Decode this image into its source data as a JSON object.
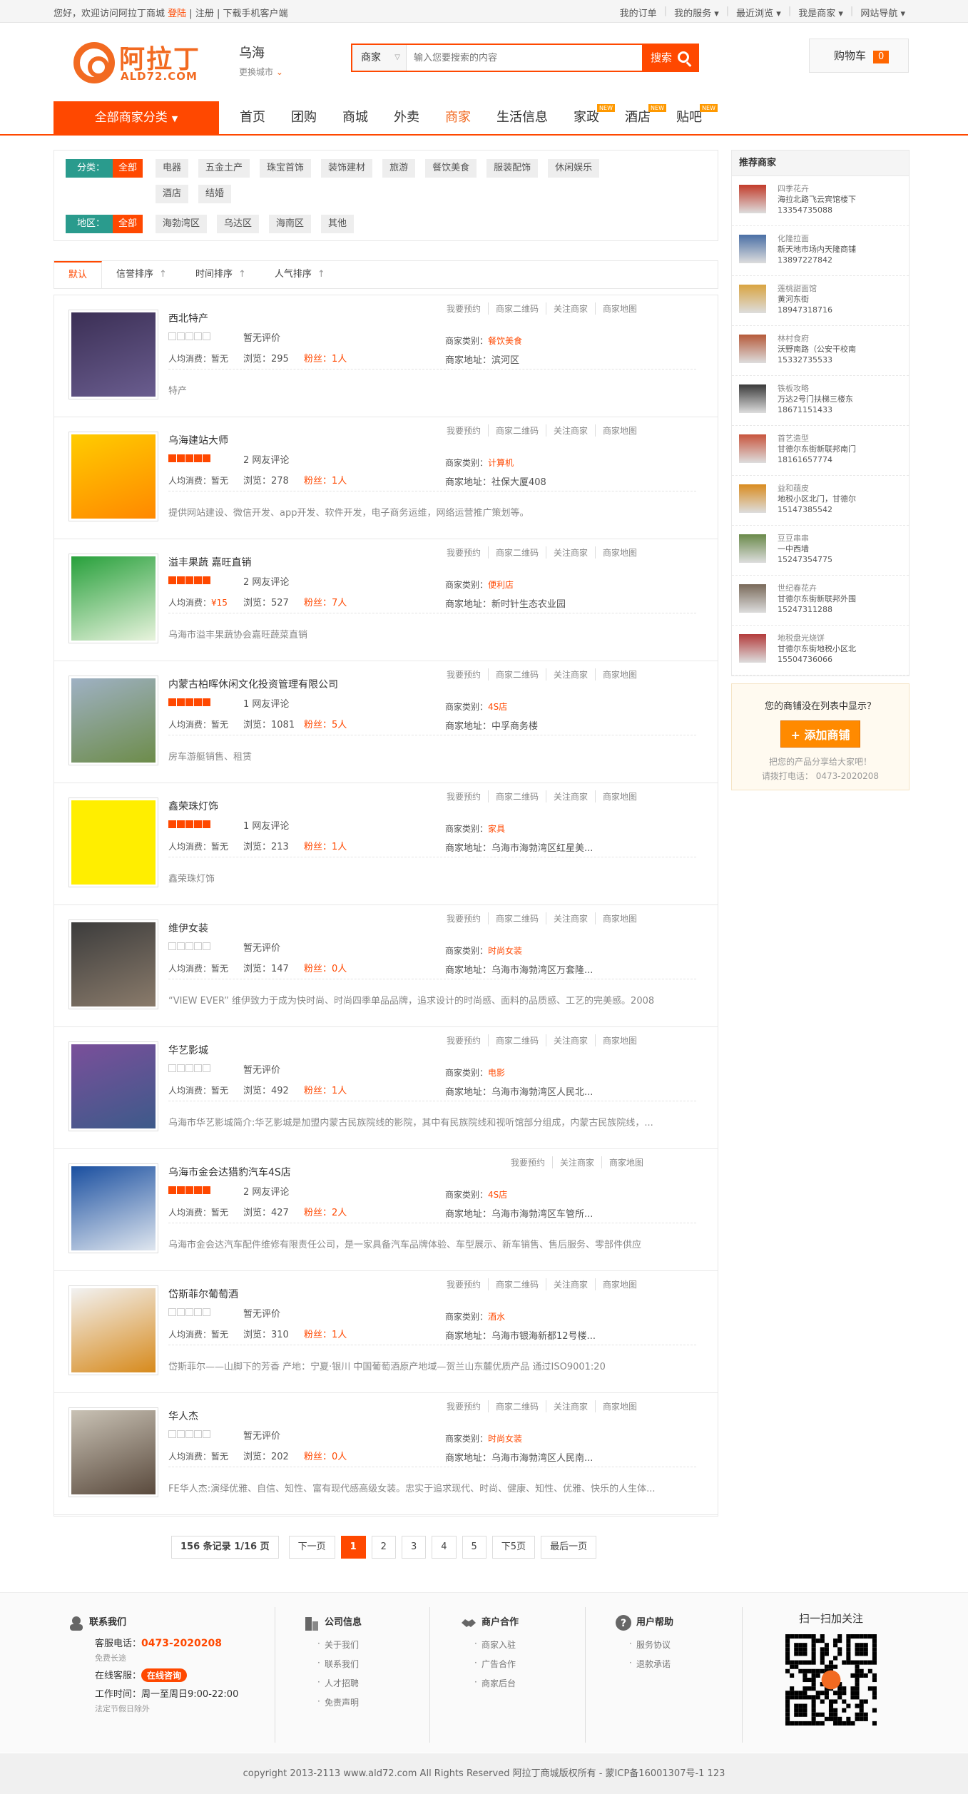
{
  "topbar": {
    "welcome": "您好，欢迎访问阿拉丁商城",
    "login": "登陆",
    "register": "注册",
    "app": "下载手机客户端",
    "links": [
      "我的订单",
      "我的服务",
      "最近浏览",
      "我是商家",
      "网站导航"
    ]
  },
  "logo": {
    "cn": "阿拉丁",
    "en": "ALD72.COM"
  },
  "city": {
    "name": "乌海",
    "change": "更换城市"
  },
  "search": {
    "type": "商家",
    "placeholder": "输入您要搜索的内容",
    "button": "搜索"
  },
  "cart": {
    "label": "购物车",
    "count": "0"
  },
  "nav": {
    "all": "全部商家分类",
    "items": [
      {
        "label": "首页"
      },
      {
        "label": "团购"
      },
      {
        "label": "商城"
      },
      {
        "label": "外卖"
      },
      {
        "label": "商家"
      },
      {
        "label": "生活信息"
      },
      {
        "label": "家政",
        "badge": "NEW"
      },
      {
        "label": "酒店",
        "badge": "NEW"
      },
      {
        "label": "贴吧",
        "badge": "NEW"
      }
    ]
  },
  "filter": {
    "cat_label": "分类：",
    "all": "全部",
    "cats": [
      "电器",
      "五金土产",
      "珠宝首饰",
      "装饰建材",
      "旅游",
      "餐饮美食",
      "服装配饰",
      "休闲娱乐",
      "酒店",
      "结婚"
    ],
    "area_label": "地区：",
    "areas": [
      "海勃湾区",
      "乌达区",
      "海南区",
      "其他"
    ]
  },
  "sort": [
    "默认",
    "信誉排序",
    "时间排序",
    "人气排序"
  ],
  "labels": {
    "avg": "人均消费：",
    "cat": "商家类别：",
    "addr": "商家地址："
  },
  "ops": [
    "我要预约",
    "商家二维码",
    "关注商家",
    "商家地图"
  ],
  "merchants": [
    {
      "name": "西北特产",
      "rating": "暂无评价",
      "avg": "暂无",
      "views": "浏览：295",
      "fans": "粉丝：1人",
      "cat": "餐饮美食",
      "addr": "滨河区",
      "desc": "特产"
    },
    {
      "name": "乌海建站大师",
      "rating": "2 网友评论",
      "avg": "暂无",
      "views": "浏览：278",
      "fans": "粉丝：1人",
      "cat": "计算机",
      "addr": "社保大厦408",
      "desc": "提供网站建设、微信开发、app开发、软件开发，电子商务运维，网络运营推广策划等。"
    },
    {
      "name": "溢丰果蔬 嘉旺直销",
      "rating": "2 网友评论",
      "avg": "¥15",
      "views": "浏览：527",
      "fans": "粉丝：7人",
      "cat": "便利店",
      "addr": "新时针生态农业园",
      "desc": "乌海市溢丰果蔬协会嘉旺蔬菜直销"
    },
    {
      "name": "内蒙古柏晖休闲文化投资管理有限公司",
      "rating": "1 网友评论",
      "avg": "暂无",
      "views": "浏览：1081",
      "fans": "粉丝：5人",
      "cat": "4S店",
      "addr": "中孚商务楼",
      "desc": "房车游艇销售、租赁"
    },
    {
      "name": "鑫荣珠灯饰",
      "rating": "1 网友评论",
      "avg": "暂无",
      "views": "浏览：213",
      "fans": "粉丝：1人",
      "cat": "家具",
      "addr": "乌海市海勃湾区红星美...",
      "desc": "鑫荣珠灯饰"
    },
    {
      "name": "维伊女装",
      "rating": "暂无评价",
      "avg": "暂无",
      "views": "浏览：147",
      "fans": "粉丝：0人",
      "cat": "时尚女装",
      "addr": "乌海市海勃湾区万套隆...",
      "desc": "“VIEW EVER” 维伊致力于成为快时尚、时尚四季单品品牌，追求设计的时尚感、面料的品质感、工艺的完美感。2008"
    },
    {
      "name": "华艺影城",
      "rating": "暂无评价",
      "avg": "暂无",
      "views": "浏览：492",
      "fans": "粉丝：1人",
      "cat": "电影",
      "addr": "乌海市海勃湾区人民北...",
      "desc": "乌海市华艺影城简介:华艺影城是加盟内蒙古民族院线的影院，其中有民族院线和视听馆部分组成，内蒙古民族院线，..."
    },
    {
      "name": "乌海市金会达猎豹汽车4S店",
      "rating": "2 网友评论",
      "avg": "暂无",
      "views": "浏览：427",
      "fans": "粉丝：2人",
      "cat": "4S店",
      "addr": "乌海市海勃湾区车管所...",
      "desc": "乌海市金会达汽车配件维修有限责任公司，是一家具备汽车品牌体验、车型展示、新车销售、售后服务、零部件供应"
    },
    {
      "name": "岱斯菲尔葡萄酒",
      "rating": "暂无评价",
      "avg": "暂无",
      "views": "浏览：310",
      "fans": "粉丝：1人",
      "cat": "酒水",
      "addr": "乌海市银海新都12号楼...",
      "desc": "岱斯菲尔——山脚下的芳香 产地：宁夏·银川 中国葡萄酒原产地域—贺兰山东麓优质产品 通过ISO9001:20"
    },
    {
      "name": "华人杰",
      "rating": "暂无评价",
      "avg": "暂无",
      "views": "浏览：202",
      "fans": "粉丝：0人",
      "cat": "时尚女装",
      "addr": "乌海市海勃湾区人民南...",
      "desc": "FE华人杰:演绎优雅、自信、知性、富有现代感高级女装。忠实于追求现代、时尚、健康、知性、优雅、快乐的人生体..."
    }
  ],
  "pager": {
    "records": "156 条记录 1/16 页",
    "prev": "下一页",
    "pages": [
      "1",
      "2",
      "3",
      "4",
      "5"
    ],
    "next5": "下5页",
    "last": "最后一页"
  },
  "side": {
    "title": "推荐商家",
    "shops": [
      {
        "name": "四季花卉",
        "addr": "海拉北路飞云宾馆楼下",
        "tel": "13354735088"
      },
      {
        "name": "化隆拉面",
        "addr": "新天地市场内天隆商铺",
        "tel": "13897227842"
      },
      {
        "name": "莲桃甜面馆",
        "addr": "黄河东街",
        "tel": "18947318716"
      },
      {
        "name": "林村食府",
        "addr": "沃野南路（公安干校南",
        "tel": "15332735533"
      },
      {
        "name": "铁板攻略",
        "addr": "万达2号门扶梯三楼东",
        "tel": "18671151433"
      },
      {
        "name": "首艺造型",
        "addr": "甘德尔东街新联邦南门",
        "tel": "18161657774"
      },
      {
        "name": "益和蕴皮",
        "addr": "地税小区北门，甘德尔",
        "tel": "15147385542"
      },
      {
        "name": "豆豆串串",
        "addr": "一中西墙",
        "tel": "15247354775"
      },
      {
        "name": "世纪春花卉",
        "addr": "甘德尔东街新联邦外围",
        "tel": "15247311288"
      },
      {
        "name": "地税盘光烧饼",
        "addr": "甘德尔东街地税小区北",
        "tel": "15504736066"
      }
    ],
    "add_q": "您的商铺没在列表中显示？",
    "add_btn": "+ 添加商铺",
    "add_s1": "把您的产品分享给大家吧！",
    "add_s2": "请拨打电话： 0473-2020208"
  },
  "footer": {
    "contact": {
      "title": "联系我们",
      "tel_label": "客服电话：",
      "tel": "0473-2020208",
      "free": "免费长途",
      "online_label": "在线客服：",
      "online": "在线咨询",
      "hours": "工作时间：周一至周日9:00-22:00",
      "holiday": "法定节假日除外"
    },
    "company": {
      "title": "公司信息",
      "items": [
        "关于我们",
        "联系我们",
        "人才招聘",
        "免责声明"
      ]
    },
    "partner": {
      "title": "商户合作",
      "items": [
        "商家入驻",
        "广告合作",
        "商家后台"
      ]
    },
    "help": {
      "title": "用户帮助",
      "items": [
        "服务协议",
        "退款承诺"
      ]
    },
    "qr": "扫一扫加关注"
  },
  "copyright": "copyright 2013-2113 www.ald72.com All Rights Reserved 阿拉丁商城版权所有 - 蒙ICP备16001307号-1 123"
}
